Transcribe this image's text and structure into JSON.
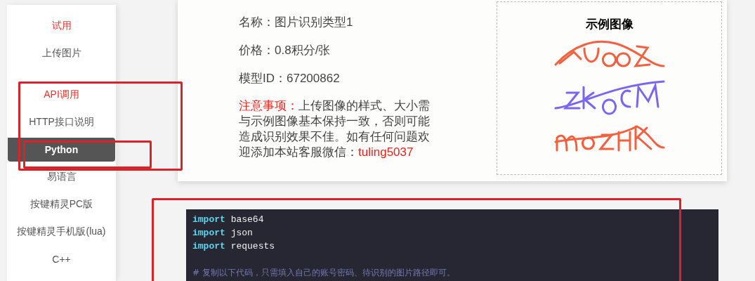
{
  "sidebar": {
    "groups": [
      {
        "items": [
          {
            "label": "试用",
            "kind": "heading",
            "selected": false
          },
          {
            "label": "上传图片",
            "kind": "link",
            "selected": false
          }
        ]
      },
      {
        "items": [
          {
            "label": "API调用",
            "kind": "heading",
            "selected": false
          },
          {
            "label": "HTTP接口说明",
            "kind": "link",
            "selected": false
          },
          {
            "label": "Python",
            "kind": "link",
            "selected": true
          },
          {
            "label": "易语言",
            "kind": "link",
            "selected": false
          },
          {
            "label": "按键精灵PC版",
            "kind": "link",
            "selected": false
          },
          {
            "label": "按键精灵手机版(lua)",
            "kind": "link",
            "selected": false
          },
          {
            "label": "C++",
            "kind": "link",
            "selected": false
          }
        ]
      }
    ]
  },
  "model_card": {
    "info": [
      "名称：图片识别类型1",
      "价格：0.8积分/张",
      "模型ID：67200862"
    ],
    "notice": {
      "label": "注意事项：",
      "text": "上传图像的样式、大小需与示例图像基本保持一致，否则可能造成识别效果不佳。如有任何问题欢迎添加本站客服微信：",
      "contact": "tuling5037"
    },
    "example": {
      "title": "示例图像"
    }
  },
  "code": {
    "lines": [
      {
        "kind": "import",
        "keyword": "import",
        "text": "base64"
      },
      {
        "kind": "import",
        "keyword": "import",
        "text": "json"
      },
      {
        "kind": "import",
        "keyword": "import",
        "text": "requests"
      },
      {
        "kind": "blank"
      },
      {
        "kind": "comment",
        "text": "# 复制以下代码，只需填入自己的账号密码、待识别的图片路径即可。"
      }
    ]
  }
}
